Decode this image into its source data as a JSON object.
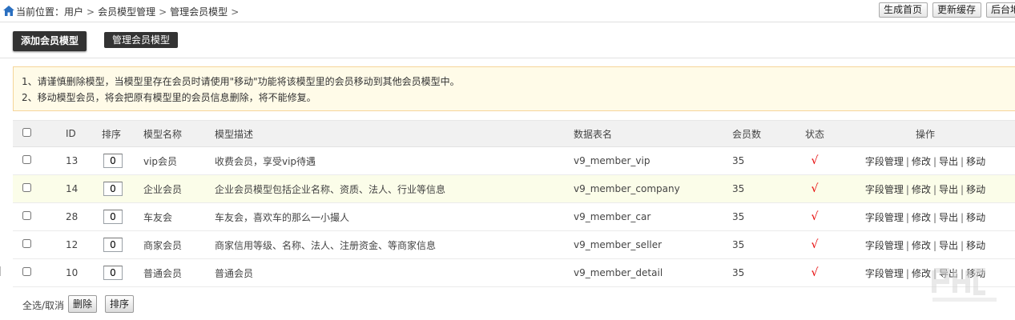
{
  "breadcrumb": {
    "prefix": "当前位置：",
    "items": [
      "用户",
      "会员模型管理",
      "管理会员模型"
    ],
    "separator": ">"
  },
  "top_buttons": [
    "生成首页",
    "更新缓存",
    "后台地图"
  ],
  "tabs": [
    {
      "label": "添加会员模型",
      "active": true
    },
    {
      "label": "管理会员模型",
      "active": false
    }
  ],
  "notice": [
    "1、请谨慎删除模型，当模型里存在会员时请使用\"移动\"功能将该模型里的会员移动到其他会员模型中。",
    "2、移动模型会员，将会把原有模型里的会员信息删除，将不能修复。"
  ],
  "table": {
    "headers": {
      "id": "ID",
      "order": "排序",
      "name": "模型名称",
      "desc": "模型描述",
      "table": "数据表名",
      "count": "会员数",
      "status": "状态",
      "ops": "操作"
    },
    "rows": [
      {
        "id": "13",
        "order": "0",
        "name": "vip会员",
        "desc": "收费会员，享受vip待遇",
        "table": "v9_member_vip",
        "count": "35",
        "status": "√"
      },
      {
        "id": "14",
        "order": "0",
        "name": "企业会员",
        "desc": "企业会员模型包括企业名称、资质、法人、行业等信息",
        "table": "v9_member_company",
        "count": "35",
        "status": "√"
      },
      {
        "id": "28",
        "order": "0",
        "name": "车友会",
        "desc": "车友会，喜欢车的那么一小撮人",
        "table": "v9_member_car",
        "count": "35",
        "status": "√"
      },
      {
        "id": "12",
        "order": "0",
        "name": "商家会员",
        "desc": "商家信用等级、名称、法人、注册资金、等商家信息",
        "table": "v9_member_seller",
        "count": "35",
        "status": "√"
      },
      {
        "id": "10",
        "order": "0",
        "name": "普通会员",
        "desc": "普通会员",
        "table": "v9_member_detail",
        "count": "35",
        "status": "√"
      }
    ],
    "highlighted_row": 1,
    "ops": [
      "字段管理",
      "修改",
      "导出",
      "移动"
    ]
  },
  "footer": {
    "select_all": "全选/取消",
    "delete_label": "删除",
    "sort_label": "排序"
  },
  "colors": {
    "tab_bg": "#333333",
    "notice_bg": "#fffbe8",
    "notice_border": "#f5d59a",
    "status_ok": "#e60000",
    "highlight_row": "#fbfde9"
  }
}
